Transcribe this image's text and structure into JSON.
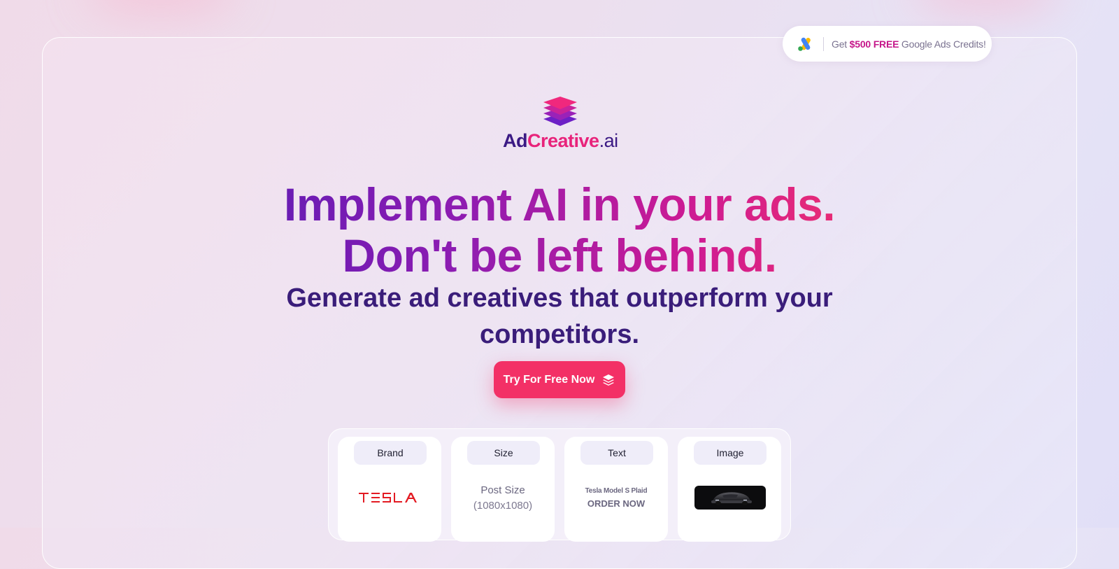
{
  "promo": {
    "icon": "google-ads-icon",
    "prefix": "Get ",
    "amount": "$500 FREE",
    "suffix": " Google Ads Credits!"
  },
  "logo": {
    "icon": "layers-stack-icon",
    "ad": "Ad",
    "creative": "Creative",
    "ai": ".ai"
  },
  "hero": {
    "headline_line1": "Implement AI in your ads.",
    "headline_line2": "Don't be left behind.",
    "subheadline": "Generate ad creatives that outperform your competitors.",
    "cta_label": "Try For Free Now",
    "cta_icon": "layers-icon"
  },
  "builder": {
    "tiles": [
      {
        "label": "Brand",
        "content_icon": "tesla-logo"
      },
      {
        "label": "Size",
        "line1": "Post Size",
        "line2": "(1080x1080)"
      },
      {
        "label": "Text",
        "line1": "Tesla Model S Plaid",
        "line2": "ORDER NOW"
      },
      {
        "label": "Image",
        "content_icon": "car-photo"
      }
    ]
  },
  "colors": {
    "brand_pink": "#f33066",
    "brand_purple": "#3a1d7a",
    "promo_accent": "#c5178a"
  }
}
